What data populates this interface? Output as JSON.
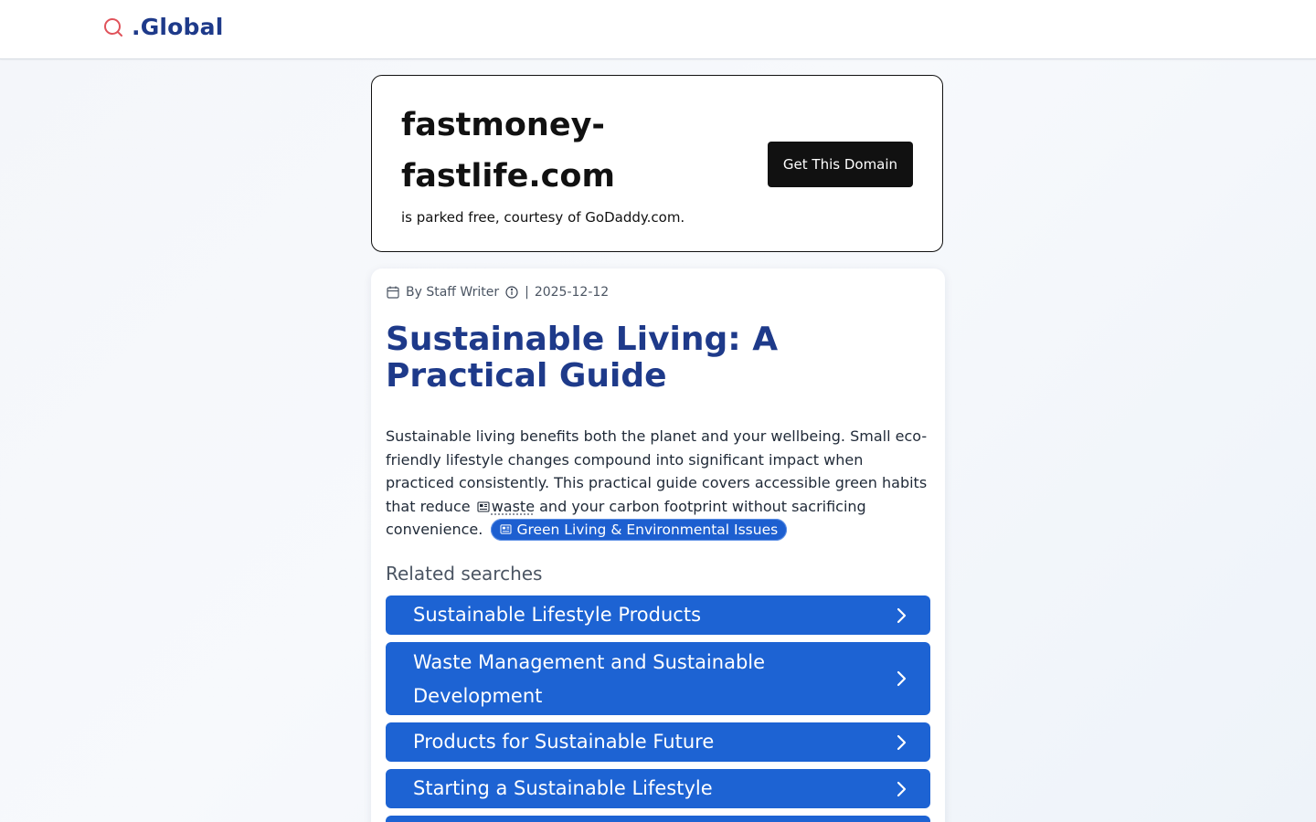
{
  "header": {
    "brand": ".Global",
    "brand_icon": "search-icon",
    "brand_icon_color": "#e0525a",
    "brand_color": "#1e3a8a"
  },
  "domain": {
    "name": "fastmoney-fastlife.com",
    "subtitle": "is parked free, courtesy of GoDaddy.com.",
    "cta_label": "Get This Domain"
  },
  "article": {
    "author": "By Staff Writer",
    "separator": "|",
    "date": "2025-12-12",
    "title": "Sustainable Living: A Practical Guide",
    "body_part1": "Sustainable living benefits both the planet and your wellbeing. Small eco-friendly lifestyle changes compound into significant impact when practiced consistently. This practical guide covers accessible green habits that reduce",
    "keyword": "waste",
    "body_part2": "and your carbon footprint without sacrificing convenience.",
    "topic_label": "Green Living & Environmental Issues",
    "accent_color": "#1d63d3"
  },
  "related": {
    "heading": "Related searches",
    "items": [
      {
        "label": "Sustainable Lifestyle Products"
      },
      {
        "label": "Waste Management and Sustainable Development"
      },
      {
        "label": "Products for Sustainable Future"
      },
      {
        "label": "Starting a Sustainable Lifestyle"
      }
    ]
  }
}
